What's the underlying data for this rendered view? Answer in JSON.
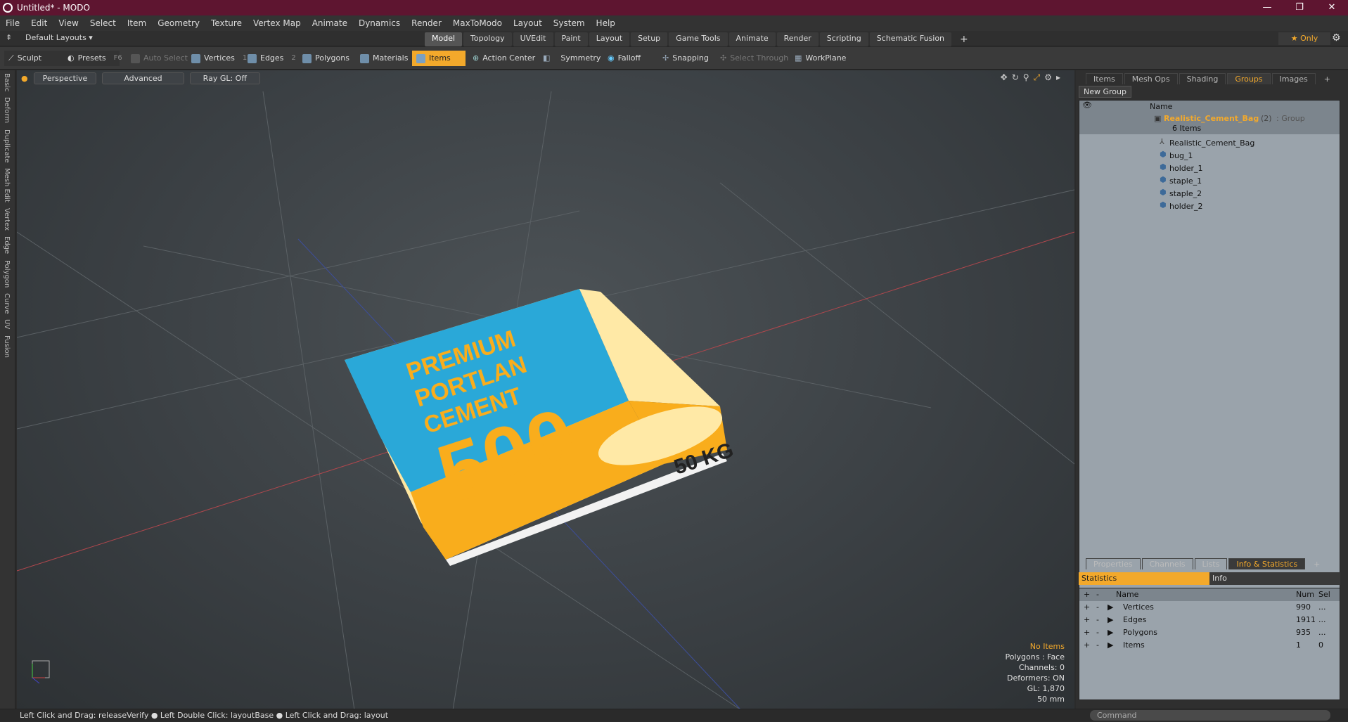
{
  "window": {
    "title": "Untitled* - MODO",
    "controls": [
      "—",
      "❐",
      "✕"
    ]
  },
  "menu": [
    "File",
    "Edit",
    "View",
    "Select",
    "Item",
    "Geometry",
    "Texture",
    "Vertex Map",
    "Animate",
    "Dynamics",
    "Render",
    "MaxToModo",
    "Layout",
    "System",
    "Help"
  ],
  "layout": {
    "selector": "Default Layouts ▾",
    "tabs": [
      "Model",
      "Topology",
      "UVEdit",
      "Paint",
      "Layout",
      "Setup",
      "Game Tools",
      "Animate",
      "Render",
      "Scripting",
      "Schematic Fusion"
    ],
    "active_tab": "Model",
    "add": "+",
    "only": "★ Only"
  },
  "toolbar": {
    "sculpt": "Sculpt",
    "presets": "Presets",
    "presets_key": "F6",
    "auto_select": "Auto Select",
    "vertices": "Vertices",
    "vertices_key": "1",
    "edges": "Edges",
    "edges_key": "2",
    "polygons": "Polygons",
    "materials": "Materials",
    "items": "Items",
    "action_center": "Action Center",
    "symmetry": "Symmetry",
    "falloff": "Falloff",
    "snapping": "Snapping",
    "select_through": "Select Through",
    "workplane": "WorkPlane"
  },
  "left_tabs": [
    "Basic",
    "Deform",
    "Duplicate",
    "Mesh Edit",
    "Vertex",
    "Edge",
    "Polygon",
    "Curve",
    "UV",
    "Fusion"
  ],
  "viewport": {
    "perspective": "Perspective",
    "advanced": "Advanced",
    "raygl": "Ray GL: Off",
    "bag": {
      "line1": "PREMIUM",
      "line2": "PORTLAN",
      "line3": "CEMENT",
      "big": "500",
      "weight": "50 KG"
    },
    "overlay": {
      "no_items": "No Items",
      "polygons": "Polygons : Face",
      "channels": "Channels: 0",
      "deformers": "Deformers: ON",
      "gl": "GL: 1,870",
      "scale": "50 mm"
    }
  },
  "groups_panel": {
    "tabs": [
      "Items",
      "Mesh Ops",
      "Shading",
      "Groups",
      "Images"
    ],
    "active": "Groups",
    "add": "+",
    "new_group": "New Group",
    "name_header": "Name",
    "group": {
      "name": "Realistic_Cement_Bag",
      "count": "(2)",
      "type": ": Group",
      "items_label": "6 Items"
    },
    "children": [
      "Realistic_Cement_Bag",
      "bug_1",
      "holder_1",
      "staple_1",
      "staple_2",
      "holder_2"
    ]
  },
  "stats_panel": {
    "tabs": [
      "Properties",
      "Channels",
      "Lists",
      "Info & Statistics"
    ],
    "active": "Info & Statistics",
    "add": "+",
    "sub_stats": "Statistics",
    "sub_info": "Info",
    "headers": {
      "plus": "+",
      "minus": "-",
      "name": "Name",
      "num": "Num",
      "sel": "Sel"
    },
    "rows": [
      {
        "name": "Vertices",
        "num": "990",
        "sel": "..."
      },
      {
        "name": "Edges",
        "num": "1911",
        "sel": "..."
      },
      {
        "name": "Polygons",
        "num": "935",
        "sel": "..."
      },
      {
        "name": "Items",
        "num": "1",
        "sel": "0"
      }
    ]
  },
  "status": {
    "hint": "Left Click and Drag: releaseVerify ● Left Double Click: layoutBase ● Left Click and Drag: layout",
    "command": "Command"
  }
}
